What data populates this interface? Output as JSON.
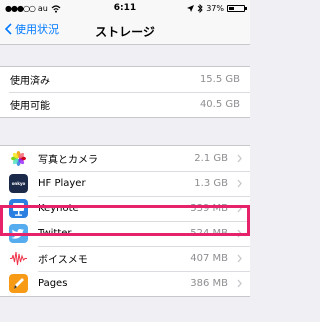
{
  "status_bar": {
    "carrier": "au",
    "time": "6:11",
    "battery": "37%",
    "battery_level": 0.37
  },
  "nav": {
    "back_label": "使用状況",
    "title": "ストレージ"
  },
  "storage": [
    {
      "label": "使用済み",
      "value": "15.5 GB"
    },
    {
      "label": "使用可能",
      "value": "40.5 GB"
    }
  ],
  "apps": [
    {
      "name": "写真とカメラ",
      "size": "2.1 GB",
      "icon": "photos-icon"
    },
    {
      "name": "HF Player",
      "size": "1.3 GB",
      "icon": "hf-player-icon",
      "icon_text": "onkyo"
    },
    {
      "name": "Keynote",
      "size": "539 MB",
      "icon": "keynote-icon"
    },
    {
      "name": "Twitter",
      "size": "524 MB",
      "icon": "twitter-icon"
    },
    {
      "name": "ボイスメモ",
      "size": "407 MB",
      "icon": "voice-memo-icon"
    },
    {
      "name": "Pages",
      "size": "386 MB",
      "icon": "pages-icon"
    }
  ],
  "colors": {
    "accent": "#007aff",
    "highlight": "#e6226a"
  }
}
